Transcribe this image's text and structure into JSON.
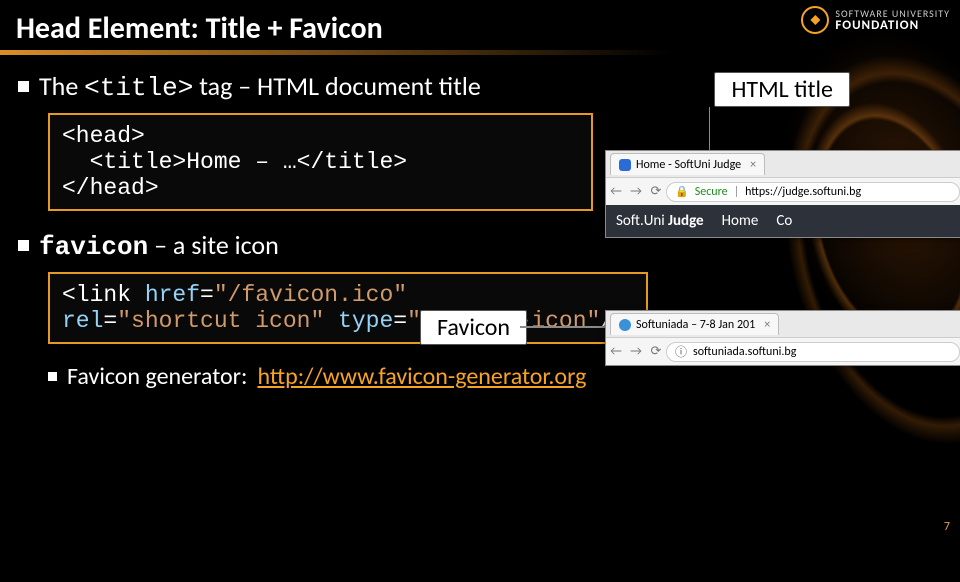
{
  "slide": {
    "title": "Head Element: Title + Favicon",
    "page_number": "7"
  },
  "logo": {
    "line1": "SOFTWARE UNIVERSITY",
    "line2": "FOUNDATION"
  },
  "bullet1": {
    "pre": "The ",
    "code": "<title>",
    "post": " tag – HTML document title"
  },
  "callout1": "HTML title",
  "code1": {
    "l1": "<head>",
    "l2a": "  <title>",
    "l2b": "Home – …",
    "l2c": "</title>",
    "l3": "</head>"
  },
  "bullet2": {
    "strong": "favicon",
    "post": " – a site icon"
  },
  "callout2": "Favicon",
  "code2": {
    "l1a": "<link ",
    "l1b": "href",
    "l1c": "=",
    "l1d": "\"/favicon.ico\"",
    "l2a": "rel",
    "l2b": "=",
    "l2c": "\"shortcut icon\" ",
    "l2d": "type",
    "l2e": "=",
    "l2f": "\"image/x-icon\"",
    "l2g": "/>"
  },
  "favgen": {
    "label": "Favicon generator: ",
    "link": "http://www.favicon-generator.org"
  },
  "browser1": {
    "tab_title": "Home - SoftUni Judge",
    "secure": "Secure",
    "url": "https://judge.softuni.bg",
    "brand_a": "Soft.",
    "brand_b": "Uni ",
    "brand_c": "Judge",
    "nav1": "Home",
    "nav2": "Co"
  },
  "browser2": {
    "tab_title": "Softuniada – 7-8 Jan 201",
    "url": "softuniada.softuni.bg",
    "info_icon": "ⓘ"
  }
}
